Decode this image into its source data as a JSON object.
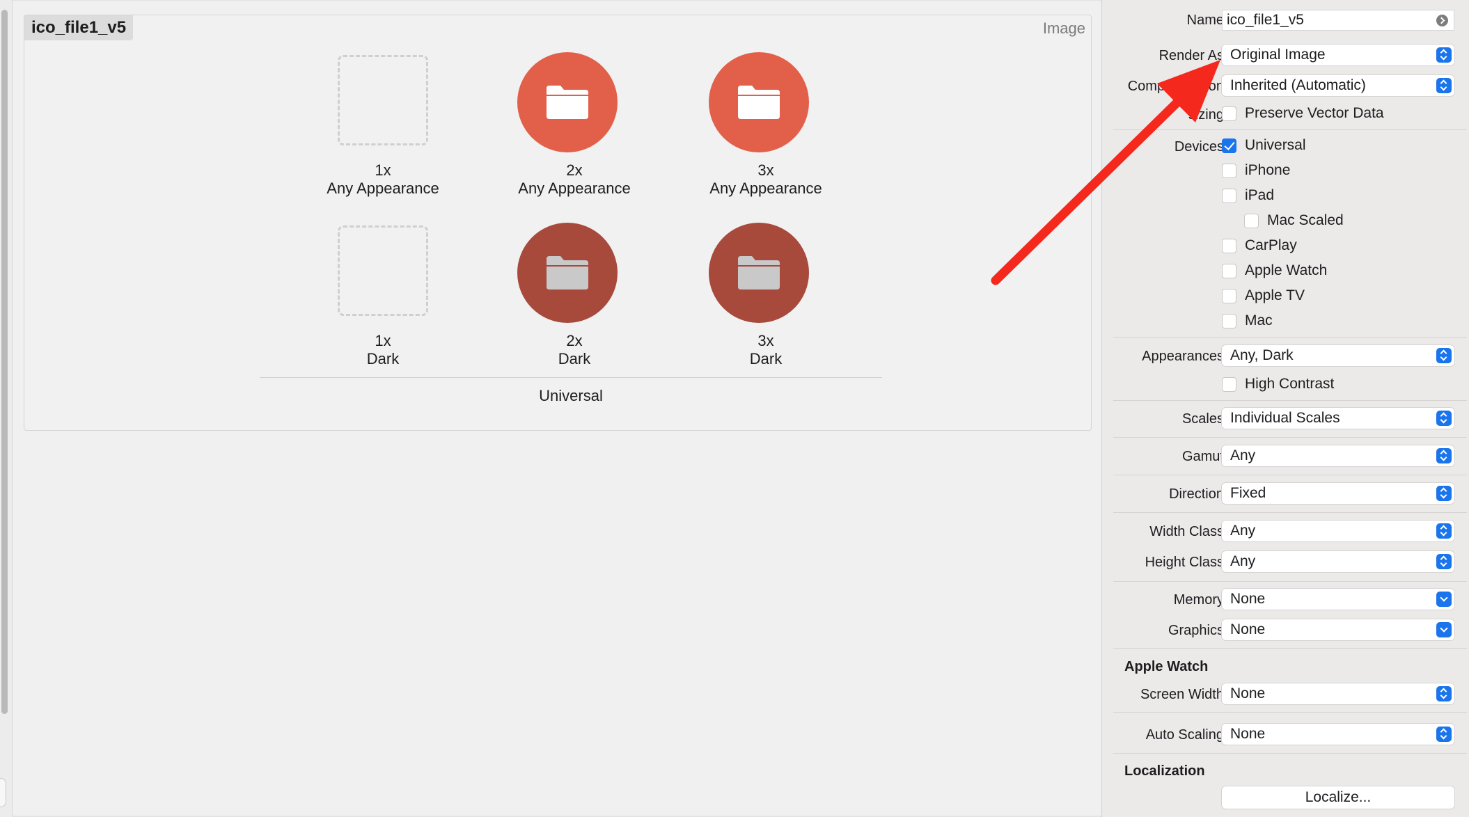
{
  "asset": {
    "name": "ico_file1_v5",
    "kind": "Image",
    "group_label": "Universal",
    "slots": [
      {
        "scale": "1x",
        "appearance": "Any Appearance",
        "filled": false
      },
      {
        "scale": "2x",
        "appearance": "Any Appearance",
        "filled": true
      },
      {
        "scale": "3x",
        "appearance": "Any Appearance",
        "filled": true
      },
      {
        "scale": "1x",
        "appearance": "Dark",
        "filled": false
      },
      {
        "scale": "2x",
        "appearance": "Dark",
        "filled": true
      },
      {
        "scale": "3x",
        "appearance": "Dark",
        "filled": true
      }
    ]
  },
  "inspector": {
    "name": {
      "label": "Name",
      "value": "ico_file1_v5"
    },
    "render_as": {
      "label": "Render As",
      "value": "Original Image"
    },
    "compression": {
      "label": "Compr",
      "label_tail": "on",
      "value": "Inherited (Automatic)"
    },
    "resizing": {
      "label": "sizing",
      "checkbox": "Preserve Vector Data",
      "checked": false
    },
    "devices": {
      "label": "Devices",
      "items": [
        {
          "label": "Universal",
          "checked": true
        },
        {
          "label": "iPhone",
          "checked": false
        },
        {
          "label": "iPad",
          "checked": false
        },
        {
          "label": "Mac Scaled",
          "checked": false
        },
        {
          "label": "CarPlay",
          "checked": false
        },
        {
          "label": "Apple Watch",
          "checked": false
        },
        {
          "label": "Apple TV",
          "checked": false
        },
        {
          "label": "Mac",
          "checked": false
        }
      ]
    },
    "appearances": {
      "label": "Appearances",
      "value": "Any, Dark",
      "high_contrast": "High Contrast",
      "high_contrast_checked": false
    },
    "scales": {
      "label": "Scales",
      "value": "Individual Scales"
    },
    "gamut": {
      "label": "Gamut",
      "value": "Any"
    },
    "direction": {
      "label": "Direction",
      "value": "Fixed"
    },
    "width_class": {
      "label": "Width Class",
      "value": "Any"
    },
    "height_class": {
      "label": "Height Class",
      "value": "Any"
    },
    "memory": {
      "label": "Memory",
      "value": "None"
    },
    "graphics": {
      "label": "Graphics",
      "value": "None"
    },
    "apple_watch": {
      "title": "Apple Watch",
      "screen_width_label": "Screen Width",
      "screen_width_value": "None",
      "auto_scaling_label": "Auto Scaling",
      "auto_scaling_value": "None"
    },
    "localization": {
      "title": "Localization",
      "button": "Localize..."
    }
  },
  "colors": {
    "accent": "#1a74ec",
    "icon_light": "#e2604a",
    "icon_dark": "#a74a3c",
    "annotation_arrow": "#f4281c"
  },
  "icons": {
    "slot_image": "folder-icon",
    "annotation": "red-arrow"
  }
}
